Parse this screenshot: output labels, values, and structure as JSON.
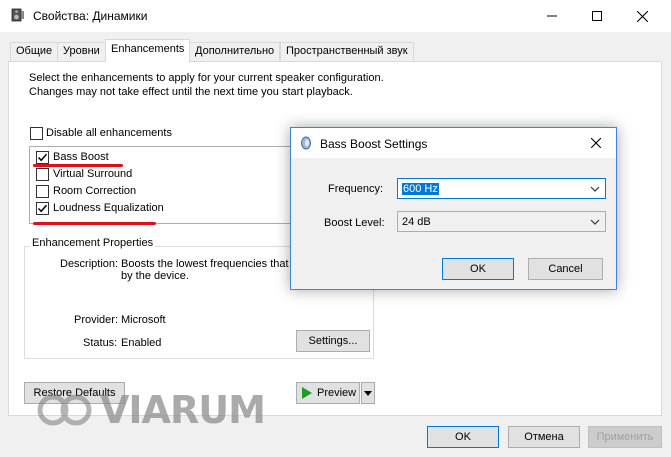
{
  "window": {
    "title": "Свойства: Динамики",
    "minimize_icon": "minimize-icon",
    "maximize_icon": "maximize-icon",
    "close_icon": "close-icon"
  },
  "tabs": [
    {
      "label": "Общие"
    },
    {
      "label": "Уровни"
    },
    {
      "label": "Enhancements",
      "active": true
    },
    {
      "label": "Дополнительно"
    },
    {
      "label": "Пространственный звук"
    }
  ],
  "enhancements": {
    "intro_text": "Select the enhancements to apply for your current speaker configuration. Changes may not take effect until the next time you start playback.",
    "disable_all": {
      "label": "Disable all enhancements",
      "checked": false
    },
    "items": [
      {
        "label": "Bass Boost",
        "checked": true
      },
      {
        "label": "Virtual Surround",
        "checked": false
      },
      {
        "label": "Room Correction",
        "checked": false
      },
      {
        "label": "Loudness Equalization",
        "checked": true
      }
    ],
    "annotation_color": "#e0101a"
  },
  "properties": {
    "legend": "Enhancement Properties",
    "description_label": "Description:",
    "description_value": "Boosts the lowest frequencies that",
    "description_value_2": "by the device.",
    "provider_label": "Provider:",
    "provider_value": "Microsoft",
    "status_label": "Status:",
    "status_value": "Enabled",
    "settings_button": "Settings..."
  },
  "bottom": {
    "restore_defaults": "Restore Defaults",
    "preview": "Preview",
    "ok": "OK",
    "cancel": "Отмена",
    "apply": "Применить"
  },
  "dialog": {
    "title": "Bass Boost Settings",
    "frequency_label": "Frequency:",
    "frequency_value": "600 Hz",
    "boost_label": "Boost Level:",
    "boost_value": "24 dB",
    "ok": "OK",
    "cancel": "Cancel",
    "accent_color": "#0078d7"
  },
  "watermark": {
    "text": "VIARUM"
  }
}
